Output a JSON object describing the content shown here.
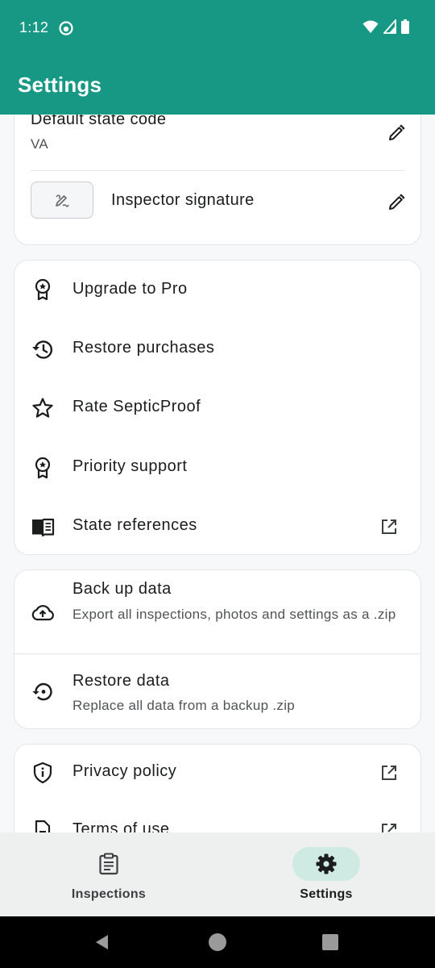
{
  "status_bar": {
    "time": "1:12"
  },
  "app_bar": {
    "title": "Settings"
  },
  "inspector_card": {
    "state_code_label": "Default state code",
    "state_code_value": "VA",
    "signature_label": "Inspector signature"
  },
  "menu_card": {
    "items": [
      {
        "label": "Upgrade to Pro",
        "icon": "award-icon"
      },
      {
        "label": "Restore purchases",
        "icon": "history-icon"
      },
      {
        "label": "Rate SepticProof",
        "icon": "star-icon"
      },
      {
        "label": "Priority support",
        "icon": "award-icon"
      },
      {
        "label": "State references",
        "icon": "book-icon",
        "trailing": "open-in-new-icon"
      }
    ]
  },
  "data_card": {
    "backup_title": "Back up data",
    "backup_subtitle": "Export all inspections, photos and settings as a .zip",
    "restore_title": "Restore data",
    "restore_subtitle": "Replace all data from a backup .zip"
  },
  "legal_card": {
    "privacy_label": "Privacy policy",
    "terms_label": "Terms of use"
  },
  "bottom_nav": {
    "items": [
      {
        "label": "Inspections",
        "icon": "clipboard-icon",
        "active": false
      },
      {
        "label": "Settings",
        "icon": "gear-icon",
        "active": true
      }
    ]
  },
  "colors": {
    "primary": "#169884",
    "active_pill": "#cfe9e3",
    "background": "#f7f8f9"
  }
}
